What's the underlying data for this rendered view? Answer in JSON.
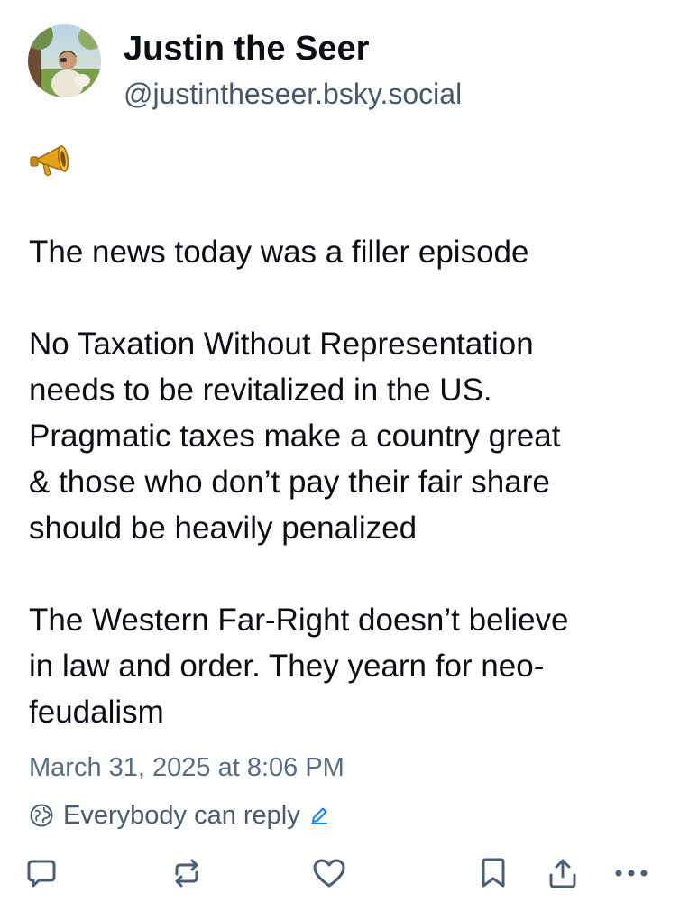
{
  "author": {
    "display_name": "Justin the Seer",
    "handle": "@justintheseer.bsky.social",
    "avatar_icon": "profile-photo"
  },
  "post": {
    "emoji": "📣",
    "paragraphs": [
      "The news today was a filler episode",
      "No Taxation Without Representation\nneeds to be revitalized in the US.\nPragmatic taxes make a country great\n& those who don’t pay their fair share\nshould be heavily penalized",
      "The Western Far-Right doesn’t believe\nin law and order. They yearn for neo-\nfeudalism"
    ],
    "timestamp": "March 31, 2025 at 8:06 PM",
    "reply_setting": "Everybody can reply"
  },
  "actions": [
    {
      "name": "reply-button",
      "icon": "speech-bubble-icon"
    },
    {
      "name": "repost-button",
      "icon": "repost-icon"
    },
    {
      "name": "like-button",
      "icon": "heart-icon"
    },
    {
      "name": "bookmark-button",
      "icon": "bookmark-icon"
    },
    {
      "name": "share-button",
      "icon": "share-icon"
    },
    {
      "name": "more-options-button",
      "icon": "ellipsis-icon"
    }
  ],
  "colors": {
    "text": "#0b0f14",
    "secondary_text": "#46566b",
    "icon": "#4d5d73",
    "accent": "#1083fe"
  }
}
